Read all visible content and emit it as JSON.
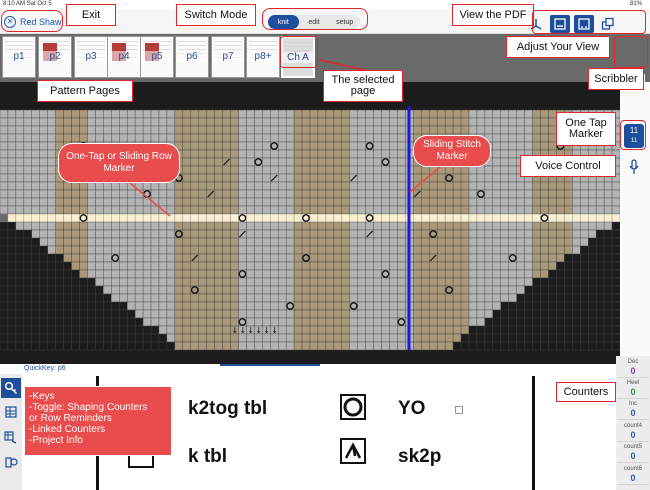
{
  "status": {
    "time_date": "8:10 AM  Sat Oct 5",
    "battery": "81%"
  },
  "header": {
    "exit_label": "Red Shawl"
  },
  "mode": {
    "options": [
      "knit",
      "edit",
      "setup"
    ],
    "active": "knit"
  },
  "pdf_icons": [
    "book-icon",
    "single-page-icon",
    "two-page-icon",
    "adjust-view-icon"
  ],
  "thumbnails": [
    "p1",
    "p2",
    "p3",
    "p4",
    "p5",
    "p6",
    "p7",
    "p8+",
    "Ch A"
  ],
  "selected_thumbnail": "Ch A",
  "marker_badge": {
    "top": "11",
    "bottom": "11"
  },
  "quickkey": "QuickKey: p6",
  "keys": [
    {
      "symbol": "k2tog-tbl-symbol",
      "label": "k2tog tbl"
    },
    {
      "symbol": "yo-symbol",
      "label": "YO"
    },
    {
      "symbol": "k-tbl-symbol",
      "label": "k tbl"
    },
    {
      "symbol": "sk2p-symbol",
      "label": "sk2p"
    }
  ],
  "counters": [
    {
      "name": "Dec",
      "value": "0",
      "color": "#8b3fa8"
    },
    {
      "name": "Heel",
      "value": "0",
      "color": "#2f9a3d"
    },
    {
      "name": "Inc",
      "value": "0",
      "color": "#2c5fb0"
    },
    {
      "name": "count4",
      "value": "0",
      "color": "#2c5fb0"
    },
    {
      "name": "count5",
      "value": "0",
      "color": "#2c5fb0"
    },
    {
      "name": "count6",
      "value": "0",
      "color": "#2c5fb0"
    }
  ],
  "annotations": {
    "exit": "Exit",
    "switch_mode": "Switch Mode",
    "view_pdf": "View the PDF",
    "adjust_view": "Adjust Your View",
    "scribbler": "Scribbler",
    "selected_page": "The selected page",
    "pattern_pages": "Pattern Pages",
    "row_marker": "One-Tap or Sliding Row Marker",
    "sliding_stitch": "Sliding Stitch Marker",
    "one_tap": "One Tap Marker",
    "voice": "Voice Control",
    "counters": "Counters",
    "keys_lines": [
      "-Keys",
      "-Toggle: Shaping Counters",
      "or Row Reminders",
      "-Linked Counters",
      "-Project Info"
    ]
  },
  "colors": {
    "accent": "#1e4f9c",
    "annotation_red": "#e0262c",
    "knit_tan": "#a9997a",
    "knit_grey": "#b3b3b3",
    "no_stitch": "#1c1c1c",
    "highlight_row": "#f6e6b8",
    "stitch_marker": "#1a1adf"
  }
}
